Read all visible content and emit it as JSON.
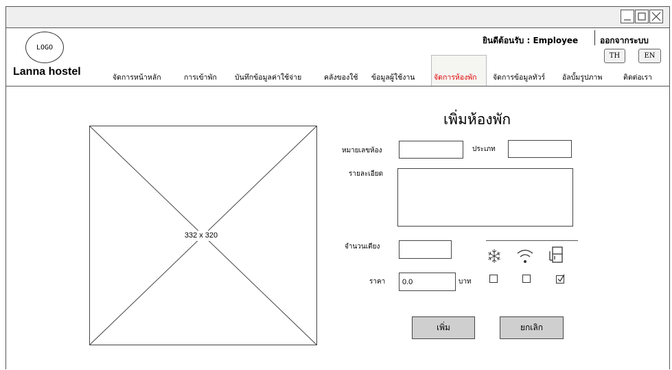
{
  "header": {
    "logo_text": "LOGO",
    "brand": "Lanna hostel",
    "welcome": "ยินดีต้อนรับ : Employee",
    "logout": "ออกจากระบบ",
    "lang_th": "TH",
    "lang_en": "EN"
  },
  "nav": {
    "items": [
      {
        "label": "จัดการหน้าหลัก"
      },
      {
        "label": "การเข้าพัก"
      },
      {
        "label": "บันทึกข้อมูลค่าใช้จ่าย"
      },
      {
        "label": "คลังของใช้"
      },
      {
        "label": "ข้อมูลผู้ใช้งาน"
      },
      {
        "label": "จัดการห้องพัก"
      },
      {
        "label": "จัดการข้อมูลทัวร์"
      },
      {
        "label": "อัลบั้มรูปภาพ"
      },
      {
        "label": "ติดต่อเรา"
      }
    ],
    "active_index": 5,
    "active_color": "#e00000"
  },
  "image_placeholder": {
    "label": "332 x 320"
  },
  "form": {
    "title": "เพิ่มห้องพัก",
    "room_number_label": "หมายเลขห้อง",
    "room_number_value": "",
    "type_label": "ประเภท",
    "type_value": "",
    "detail_label": "รายละเอียด",
    "detail_value": "",
    "beds_label": "จำนวนเตียง",
    "beds_value": "",
    "price_label": "ราคา",
    "price_value": "0.0",
    "currency": "บาท",
    "amenities": [
      {
        "icon": "snowflake-icon",
        "checked": false
      },
      {
        "icon": "wifi-icon",
        "checked": false
      },
      {
        "icon": "fridge-icon",
        "checked": true
      }
    ],
    "add_button": "เพิ่ม",
    "cancel_button": "ยกเลิก"
  }
}
